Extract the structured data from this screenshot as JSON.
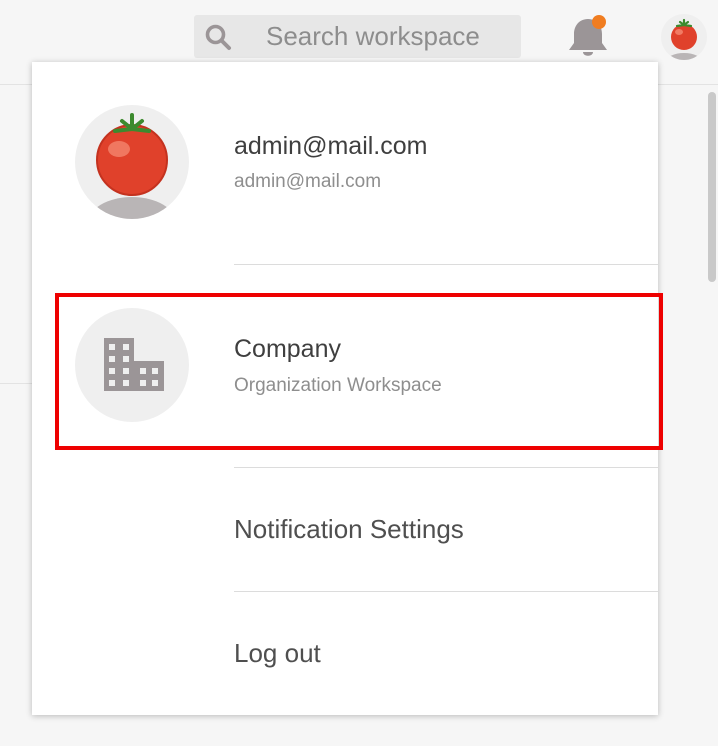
{
  "header": {
    "search": {
      "placeholder": "Search workspace",
      "icon": "search-icon"
    },
    "notifications": {
      "icon": "bell-icon",
      "badge_color": "#f07d21"
    },
    "user_avatar": {
      "icon": "tomato-avatar-icon"
    }
  },
  "account_menu": {
    "profile": {
      "name": "admin@mail.com",
      "email": "admin@mail.com"
    },
    "organization": {
      "name": "Company",
      "subtitle": "Organization Workspace",
      "icon": "building-icon"
    },
    "items": [
      {
        "label": "Notification Settings"
      },
      {
        "label": "Log out"
      }
    ]
  },
  "colors": {
    "highlight_border": "#ee0000",
    "icon_gray": "#9b9597",
    "tomato_red": "#e0412b",
    "badge_orange": "#f07d21"
  }
}
